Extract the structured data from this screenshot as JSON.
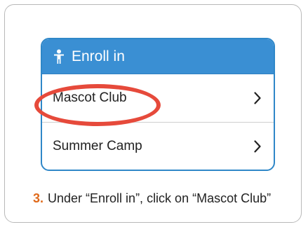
{
  "card": {
    "header_title": "Enroll in",
    "header_icon": "person-icon",
    "items": [
      {
        "label": "Mascot Club",
        "icon": "chevron-right-icon",
        "highlighted": true
      },
      {
        "label": "Summer Camp",
        "icon": "chevron-right-icon",
        "highlighted": false
      }
    ]
  },
  "instruction": {
    "step_number": "3.",
    "text": "Under “Enroll in”, click on “Mascot Club”"
  },
  "colors": {
    "header_bg": "#3a8fd3",
    "card_border": "#2f87c8",
    "highlight_ring": "#e64a3b",
    "step_number": "#e06a1b"
  }
}
